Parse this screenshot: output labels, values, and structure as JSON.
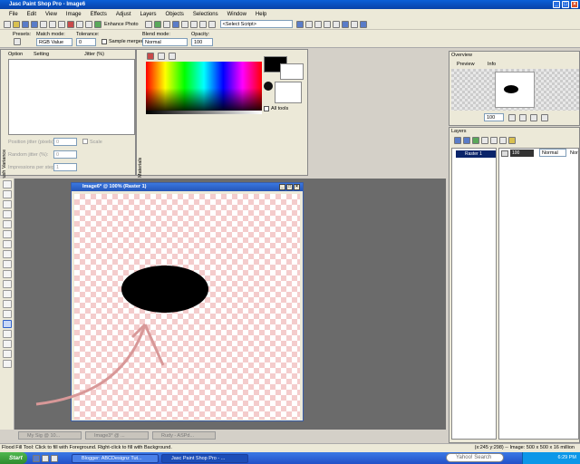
{
  "window": {
    "title": "Jasc Paint Shop Pro - Image6"
  },
  "menu": [
    "File",
    "Edit",
    "View",
    "Image",
    "Effects",
    "Adjust",
    "Layers",
    "Objects",
    "Selections",
    "Window",
    "Help"
  ],
  "toolbar": {
    "enhance_label": "Enhance Photo",
    "script_select": "<Select Script>"
  },
  "tool_options": {
    "presets_label": "Presets:",
    "match_mode_label": "Match mode:",
    "match_mode_value": "RGB Value",
    "tolerance_label": "Tolerance:",
    "tolerance_value": "0",
    "sample_merged_label": "Sample merged",
    "blend_mode_label": "Blend mode:",
    "blend_mode_value": "Normal",
    "opacity_label": "Opacity:",
    "opacity_value": "100"
  },
  "brush_variance": {
    "col_option": "Option",
    "col_setting": "Setting",
    "col_jitter": "Jitter (%)",
    "position_jitter": "Position jitter (pixels):",
    "position_jitter_value": "0",
    "random_jitter": "Random jitter (%):",
    "random_jitter_value": "0",
    "impressions": "Impressions per step:",
    "impressions_value": "1",
    "scale_label": "Scale",
    "side_label": "Brush Variance"
  },
  "materials": {
    "side_label": "Materials",
    "all_tools_label": "All tools"
  },
  "overview": {
    "title": "Overview",
    "tab_preview": "Preview",
    "tab_info": "Info",
    "zoom_value": "100"
  },
  "layers": {
    "title": "Layers",
    "layer_name": "Raster 1",
    "opacity": "100",
    "blend": "Normal",
    "lock_label": "Nor"
  },
  "image_window": {
    "title": "Image6* @ 100% (Raster 1)"
  },
  "tabs": [
    "My Sig @ 10...",
    "Image3* @ ...",
    "Rudy - ASPd..."
  ],
  "status": {
    "hint": "Flood Fill Tool: Click to fill with Foreground. Right-click to fill with Background.",
    "coords": "(x:245 y:298) -- Image:  500 x 500 x 16 million"
  },
  "taskbar": {
    "start": "Start",
    "task1": "Blogger: ABCDesignz Tut...",
    "task2": "Jasc Paint Shop Pro - ...",
    "search": "Yahoo! Search",
    "clock": "6:29 PM"
  }
}
